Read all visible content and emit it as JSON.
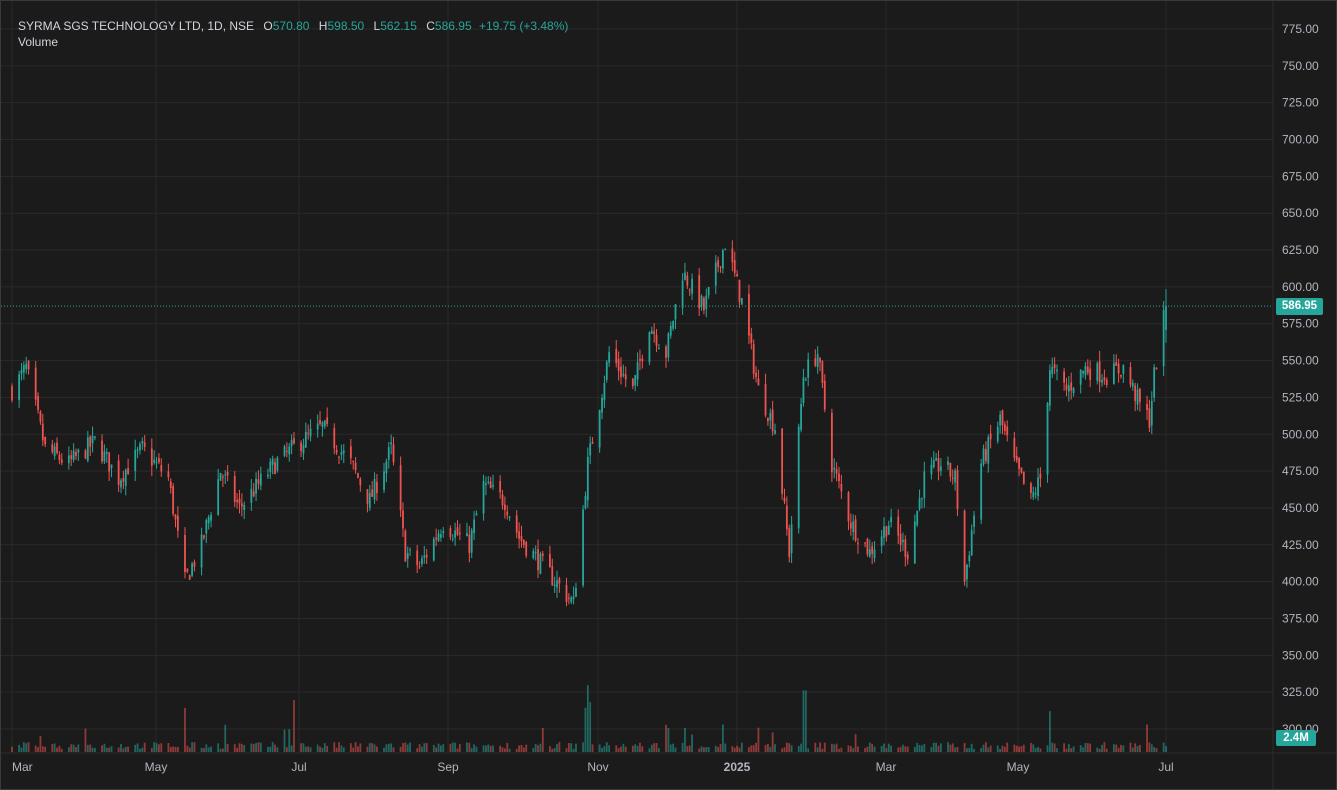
{
  "legend": {
    "symbol": "SYRMA SGS TECHNOLOGY LTD, 1D, NSE",
    "o_label": "O",
    "o_value": "570.80",
    "h_label": "H",
    "h_value": "598.50",
    "l_label": "L",
    "l_value": "562.15",
    "c_label": "C",
    "c_value": "586.95",
    "change": "+19.75 (+3.48%)",
    "volume_label": "Volume"
  },
  "last_price_tag": "586.95",
  "volume_tag": "2.4M",
  "colors": {
    "up": "#26a69a",
    "down": "#ef5350",
    "background": "#1b1b1b",
    "grid": "#2a2a2a",
    "axis_text": "#b2b5be"
  },
  "chart_data": {
    "type": "candlestick",
    "title": "SYRMA SGS TECHNOLOGY LTD, 1D, NSE",
    "ylim": [
      290,
      790
    ],
    "y_ticks": [
      "775.00",
      "750.00",
      "725.00",
      "700.00",
      "675.00",
      "650.00",
      "625.00",
      "600.00",
      "575.00",
      "550.00",
      "525.00",
      "500.00",
      "475.00",
      "450.00",
      "425.00",
      "400.00",
      "375.00",
      "350.00",
      "325.00",
      "300.00"
    ],
    "x_labels": [
      "Mar",
      "May",
      "Jul",
      "Sep",
      "Nov",
      "2025",
      "Mar",
      "May",
      "Jul"
    ],
    "last_close": 586.95,
    "grid": true,
    "legend_position": "top-left",
    "anchors": [
      {
        "date": "2024-03-01",
        "close": 530
      },
      {
        "date": "2024-03-07",
        "close": 545
      },
      {
        "date": "2024-03-15",
        "close": 490
      },
      {
        "date": "2024-03-25",
        "close": 480
      },
      {
        "date": "2024-04-05",
        "close": 495
      },
      {
        "date": "2024-04-15",
        "close": 470
      },
      {
        "date": "2024-04-25",
        "close": 490
      },
      {
        "date": "2024-05-06",
        "close": 470
      },
      {
        "date": "2024-05-13",
        "close": 400
      },
      {
        "date": "2024-05-20",
        "close": 425
      },
      {
        "date": "2024-05-28",
        "close": 475
      },
      {
        "date": "2024-06-05",
        "close": 450
      },
      {
        "date": "2024-06-20",
        "close": 480
      },
      {
        "date": "2024-07-01",
        "close": 495
      },
      {
        "date": "2024-07-10",
        "close": 505
      },
      {
        "date": "2024-07-22",
        "close": 480
      },
      {
        "date": "2024-07-30",
        "close": 455
      },
      {
        "date": "2024-08-08",
        "close": 490
      },
      {
        "date": "2024-08-14",
        "close": 420
      },
      {
        "date": "2024-08-20",
        "close": 410
      },
      {
        "date": "2024-08-30",
        "close": 440
      },
      {
        "date": "2024-09-10",
        "close": 425
      },
      {
        "date": "2024-09-16",
        "close": 465
      },
      {
        "date": "2024-09-25",
        "close": 455
      },
      {
        "date": "2024-10-01",
        "close": 430
      },
      {
        "date": "2024-10-14",
        "close": 405
      },
      {
        "date": "2024-10-24",
        "close": 385
      },
      {
        "date": "2024-10-30",
        "close": 480
      },
      {
        "date": "2024-11-08",
        "close": 555
      },
      {
        "date": "2024-11-18",
        "close": 530
      },
      {
        "date": "2024-11-25",
        "close": 575
      },
      {
        "date": "2024-12-02",
        "close": 555
      },
      {
        "date": "2024-12-09",
        "close": 610
      },
      {
        "date": "2024-12-18",
        "close": 585
      },
      {
        "date": "2024-12-27",
        "close": 630
      },
      {
        "date": "2025-01-03",
        "close": 590
      },
      {
        "date": "2025-01-10",
        "close": 530
      },
      {
        "date": "2025-01-17",
        "close": 505
      },
      {
        "date": "2025-01-23",
        "close": 420
      },
      {
        "date": "2025-01-29",
        "close": 540
      },
      {
        "date": "2025-02-04",
        "close": 555
      },
      {
        "date": "2025-02-10",
        "close": 480
      },
      {
        "date": "2025-02-18",
        "close": 440
      },
      {
        "date": "2025-02-26",
        "close": 420
      },
      {
        "date": "2025-03-06",
        "close": 440
      },
      {
        "date": "2025-03-14",
        "close": 420
      },
      {
        "date": "2025-03-21",
        "close": 470
      },
      {
        "date": "2025-03-28",
        "close": 480
      },
      {
        "date": "2025-04-03",
        "close": 470
      },
      {
        "date": "2025-04-07",
        "close": 400
      },
      {
        "date": "2025-04-14",
        "close": 480
      },
      {
        "date": "2025-04-22",
        "close": 510
      },
      {
        "date": "2025-04-28",
        "close": 480
      },
      {
        "date": "2025-05-05",
        "close": 455
      },
      {
        "date": "2025-05-09",
        "close": 470
      },
      {
        "date": "2025-05-13",
        "close": 545
      },
      {
        "date": "2025-05-20",
        "close": 530
      },
      {
        "date": "2025-05-28",
        "close": 545
      },
      {
        "date": "2025-06-06",
        "close": 540
      },
      {
        "date": "2025-06-13",
        "close": 545
      },
      {
        "date": "2025-06-20",
        "close": 520
      },
      {
        "date": "2025-06-24",
        "close": 510
      },
      {
        "date": "2025-06-26",
        "close": 540
      },
      {
        "date": "2025-07-01",
        "close": 586.95
      }
    ]
  }
}
